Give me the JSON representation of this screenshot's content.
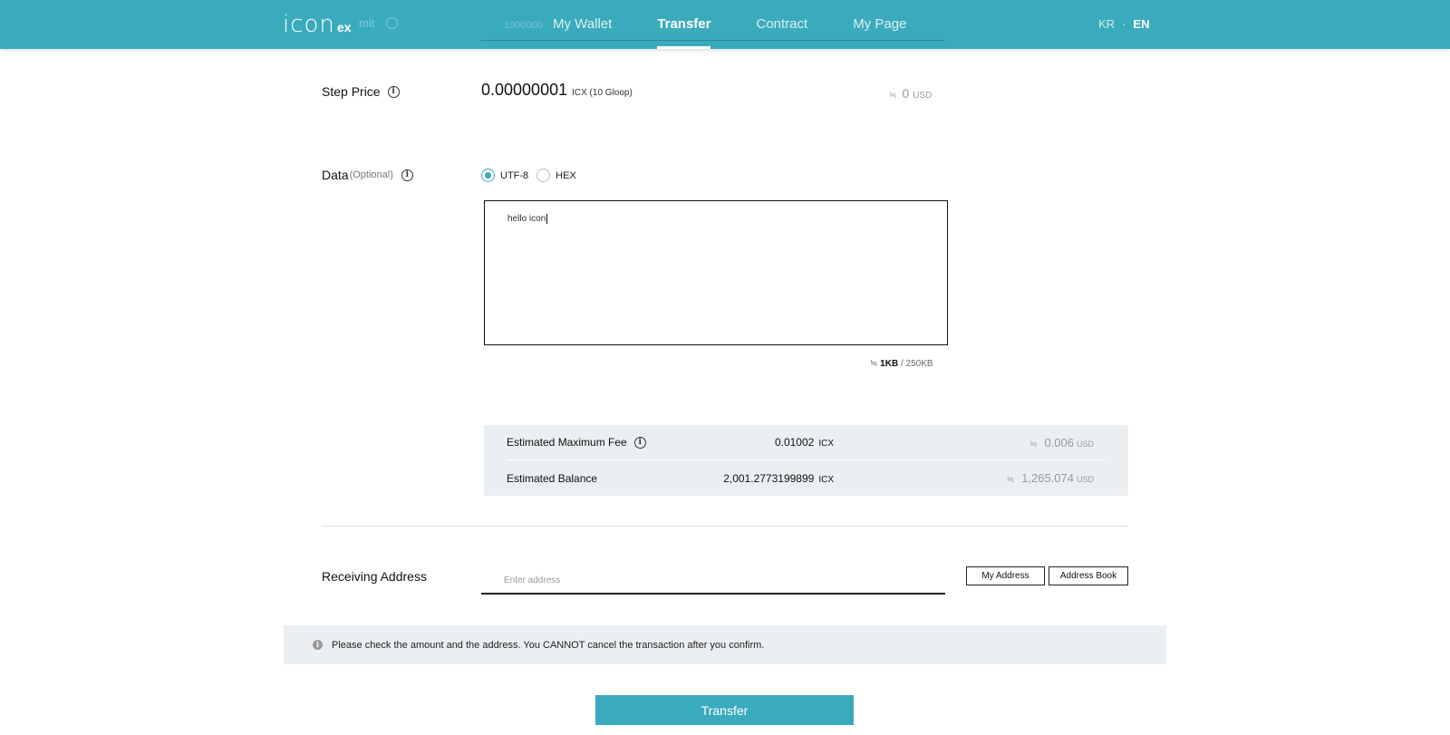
{
  "header": {
    "logo_main": "icon",
    "logo_sub": "ex",
    "ghost_label": "mit",
    "ghost_label2": "1000000",
    "nav": [
      "My Wallet",
      "Transfer",
      "Contract",
      "My Page"
    ],
    "active_nav": "Transfer",
    "lang": [
      "KR",
      "·",
      "EN"
    ],
    "active_lang": "EN"
  },
  "step_price": {
    "label": "Step Price",
    "value": "0.00000001",
    "unit": "ICX (10 Gloop)",
    "usd_approx": "≒",
    "usd_value": "0",
    "usd_unit": "USD"
  },
  "data_field": {
    "label": "Data",
    "optional": "(Optional)",
    "options": [
      "UTF-8",
      "HEX"
    ],
    "selected": "UTF-8",
    "value": "hello icon",
    "size_approx": "≒",
    "size_used": "1KB",
    "size_limit": " / 250KB"
  },
  "fee": {
    "max_label": "Estimated Maximum Fee",
    "max_value": "0.01002",
    "max_unit": "ICX",
    "max_usd_approx": "≒",
    "max_usd": "0.006",
    "max_usd_unit": "USD",
    "balance_label": "Estimated Balance",
    "balance_value": "2,001.2773199899",
    "balance_unit": "ICX",
    "balance_usd_approx": "≒",
    "balance_usd": "1,265.074",
    "balance_usd_unit": "USD"
  },
  "receiving": {
    "label": "Receiving Address",
    "placeholder": "Enter address",
    "my_address": "My Address",
    "address_book": "Address Book"
  },
  "notice": {
    "icon": "i",
    "text": "Please check the amount and the address. You CANNOT cancel the transaction after you confirm."
  },
  "transfer_button": "Transfer"
}
